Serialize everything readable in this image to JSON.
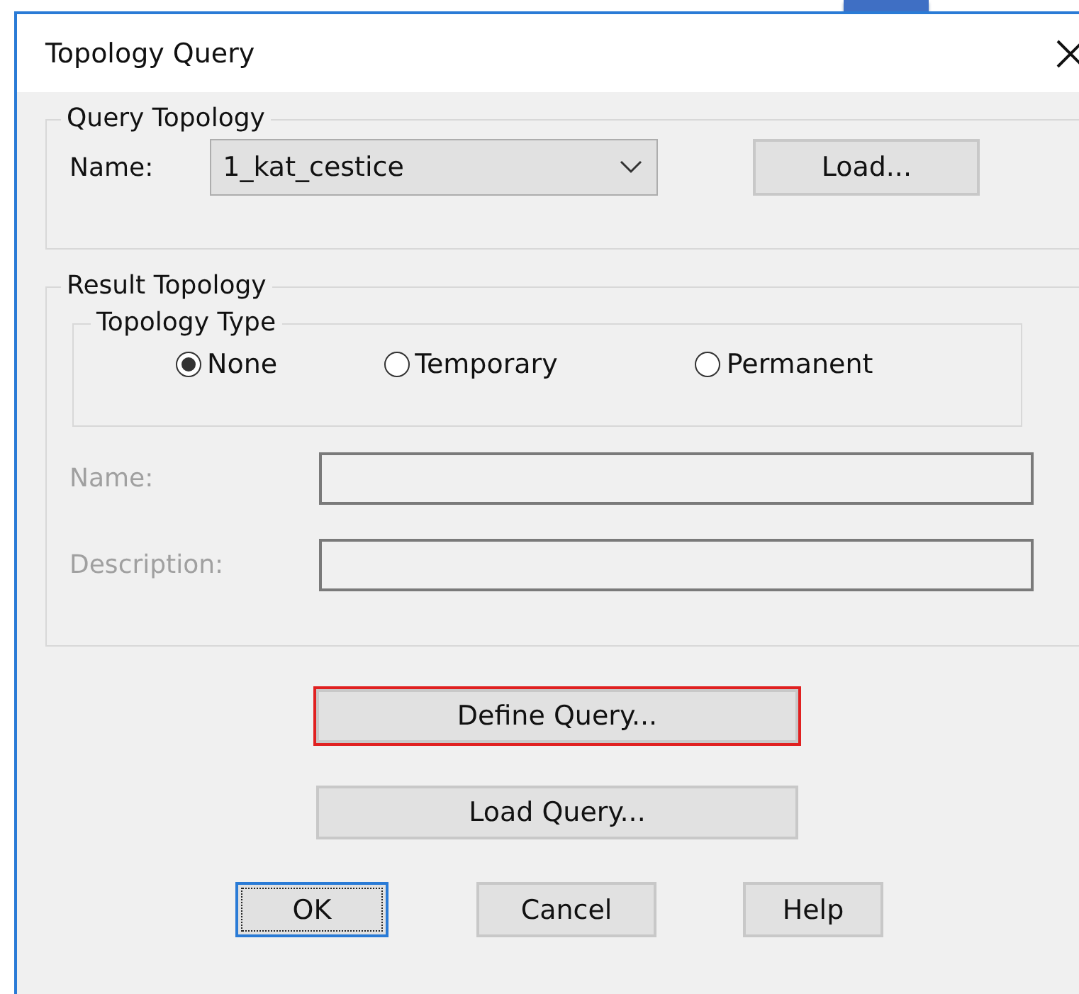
{
  "window": {
    "title": "Topology Query"
  },
  "query_topology": {
    "title": "Query Topology",
    "name_label": "Name:",
    "name_value": "1_kat_cestice",
    "load_button": "Load..."
  },
  "result_topology": {
    "title": "Result Topology",
    "type_group": {
      "title": "Topology Type",
      "options": [
        {
          "label": "None",
          "selected": true
        },
        {
          "label": "Temporary",
          "selected": false
        },
        {
          "label": "Permanent",
          "selected": false
        }
      ]
    },
    "fields": [
      {
        "label": "Name:",
        "disabled": true
      },
      {
        "label": "Description:",
        "disabled": true
      }
    ]
  },
  "actions": [
    {
      "label": "Define Query...",
      "highlighted": true
    },
    {
      "label": "Load Query...",
      "highlighted": false
    }
  ],
  "buttons": [
    {
      "label": "OK",
      "default": true
    },
    {
      "label": "Cancel",
      "default": false
    },
    {
      "label": "Help",
      "default": false
    }
  ]
}
